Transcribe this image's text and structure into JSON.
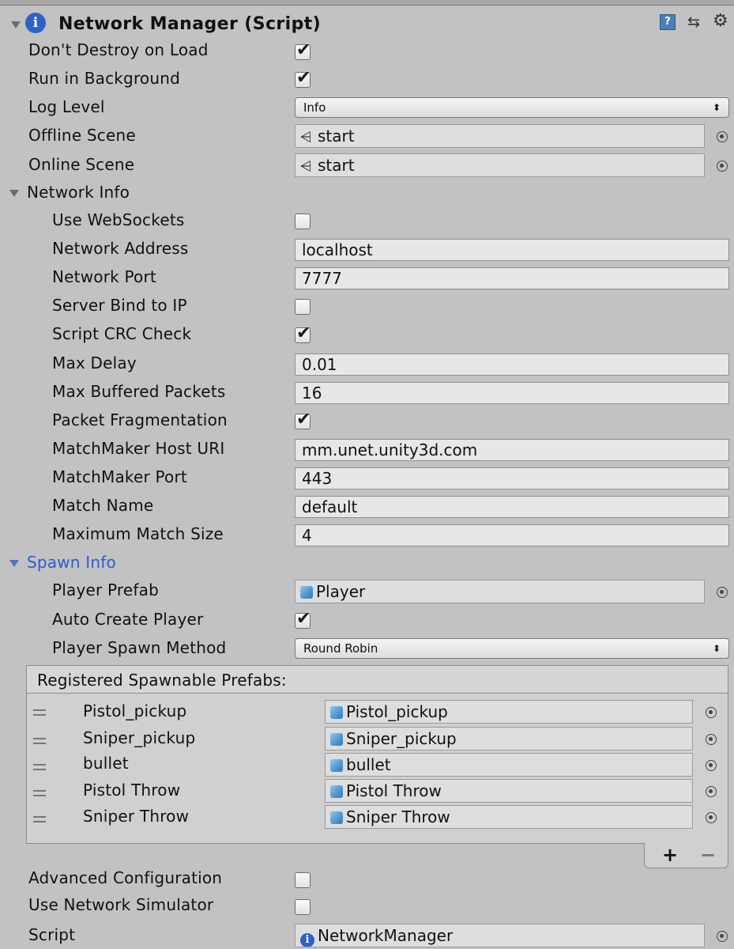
{
  "component": {
    "title": "Network Manager (Script)"
  },
  "general": {
    "dont_destroy_label": "Don't Destroy on Load",
    "dont_destroy_checked": true,
    "run_background_label": "Run in Background",
    "run_background_checked": true,
    "log_level_label": "Log Level",
    "log_level_value": "Info",
    "offline_scene_label": "Offline Scene",
    "offline_scene_value": "start",
    "online_scene_label": "Online Scene",
    "online_scene_value": "start"
  },
  "network_info": {
    "label": "Network Info",
    "use_websockets_label": "Use WebSockets",
    "use_websockets_checked": false,
    "network_address_label": "Network Address",
    "network_address_value": "localhost",
    "network_port_label": "Network Port",
    "network_port_value": "7777",
    "server_bind_label": "Server Bind to IP",
    "server_bind_checked": false,
    "script_crc_label": "Script CRC Check",
    "script_crc_checked": true,
    "max_delay_label": "Max Delay",
    "max_delay_value": "0.01",
    "max_buffered_label": "Max Buffered Packets",
    "max_buffered_value": "16",
    "packet_frag_label": "Packet Fragmentation",
    "packet_frag_checked": true,
    "mm_host_label": "MatchMaker Host URI",
    "mm_host_value": "mm.unet.unity3d.com",
    "mm_port_label": "MatchMaker Port",
    "mm_port_value": "443",
    "match_name_label": "Match Name",
    "match_name_value": "default",
    "max_match_label": "Maximum Match Size",
    "max_match_value": "4"
  },
  "spawn_info": {
    "label": "Spawn Info",
    "player_prefab_label": "Player Prefab",
    "player_prefab_value": "Player",
    "auto_create_label": "Auto Create Player",
    "auto_create_checked": true,
    "spawn_method_label": "Player Spawn Method",
    "spawn_method_value": "Round Robin",
    "registered_label": "Registered Spawnable Prefabs:",
    "prefabs": [
      {
        "name": "Pistol_pickup",
        "value": "Pistol_pickup"
      },
      {
        "name": "Sniper_pickup",
        "value": "Sniper_pickup"
      },
      {
        "name": "bullet",
        "value": "bullet"
      },
      {
        "name": "Pistol Throw",
        "value": "Pistol Throw"
      },
      {
        "name": "Sniper Throw",
        "value": "Sniper Throw"
      }
    ],
    "add_label": "+",
    "remove_label": "−"
  },
  "advanced": {
    "advanced_config_label": "Advanced Configuration",
    "advanced_config_checked": false,
    "network_sim_label": "Use Network Simulator",
    "network_sim_checked": false
  },
  "script": {
    "label": "Script",
    "value": "NetworkManager"
  },
  "icons": {
    "info": "info-icon",
    "help": "help-icon",
    "preset": "preset-icon",
    "gear": "gear-icon",
    "scene": "scene-asset-icon",
    "prefab": "prefab-cube-icon",
    "picker": "object-picker-icon"
  },
  "colors": {
    "panel_bg": "#c2c2c2",
    "field_bg": "#e7e7e7",
    "accent_blue": "#2d5ec9"
  }
}
